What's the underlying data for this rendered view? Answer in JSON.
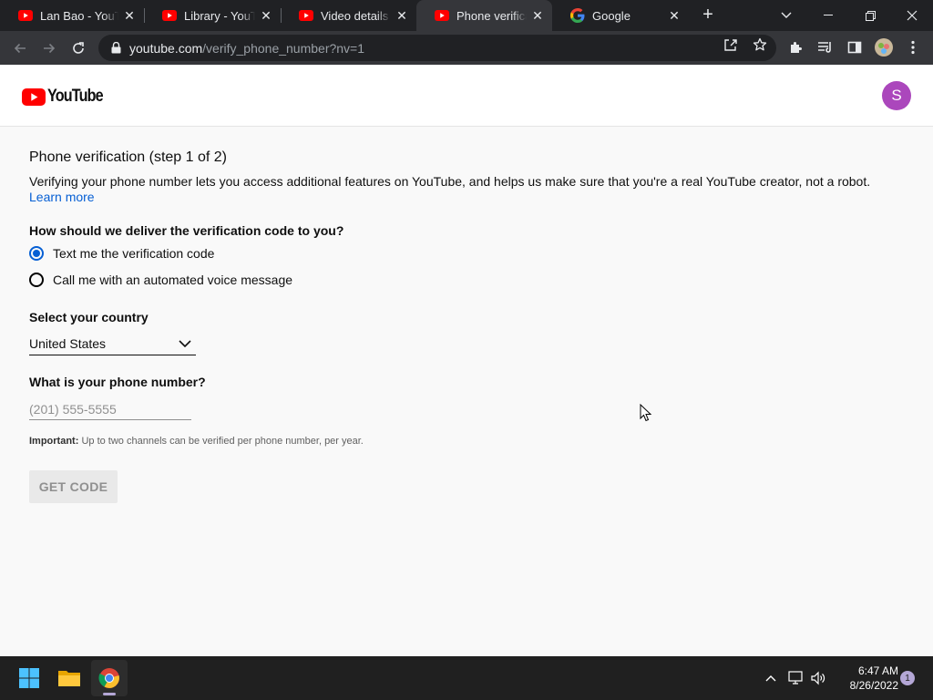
{
  "browser": {
    "tabs": [
      {
        "title": "Lan Bao - YouTube",
        "icon": "youtube-favicon",
        "active": false
      },
      {
        "title": "Library - YouTube",
        "icon": "youtube-favicon",
        "active": false
      },
      {
        "title": "Video details - YouTube Studio",
        "icon": "youtube-favicon",
        "active": false
      },
      {
        "title": "Phone verification",
        "icon": "youtube-favicon",
        "active": true
      },
      {
        "title": "Google",
        "icon": "google-favicon",
        "active": false
      }
    ],
    "url_host": "youtube.com",
    "url_path": "/verify_phone_number?nv=1"
  },
  "header": {
    "logo_text": "YouTube",
    "avatar_letter": "S",
    "avatar_color": "#ab47bc"
  },
  "page": {
    "title": "Phone verification (step 1 of 2)",
    "description": "Verifying your phone number lets you access additional features on YouTube, and helps us make sure that you're a real YouTube creator, not a robot.",
    "learn_more": "Learn more",
    "delivery_question": "How should we deliver the verification code to you?",
    "delivery_options": [
      {
        "label": "Text me the verification code",
        "selected": true
      },
      {
        "label": "Call me with an automated voice message",
        "selected": false
      }
    ],
    "country_label": "Select your country",
    "country_value": "United States",
    "phone_label": "What is your phone number?",
    "phone_placeholder": "(201) 555-5555",
    "phone_value": "",
    "important_label": "Important:",
    "important_text": "Up to two channels can be verified per phone number, per year.",
    "get_code_label": "GET CODE"
  },
  "taskbar": {
    "time": "6:47 AM",
    "date": "8/26/2022",
    "notification_count": "1"
  },
  "colors": {
    "accent": "#065fd4",
    "youtube_red": "#ff0000"
  }
}
